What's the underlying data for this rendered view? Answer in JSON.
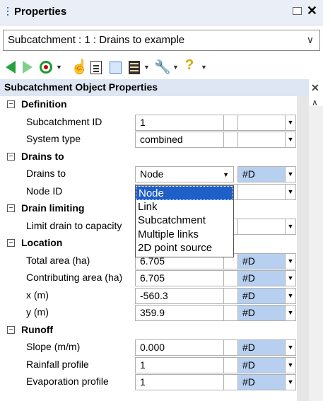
{
  "window": {
    "title": "Properties"
  },
  "object_selector": {
    "value": "Subcatchment : 1 : Drains to example"
  },
  "toolbar": {
    "icons": [
      "back-arrow-icon",
      "forward-arrow-icon",
      "target-icon",
      "hand-pointer-icon",
      "document-icon",
      "selection-icon",
      "list-icon",
      "wrench-icon",
      "help-icon"
    ]
  },
  "panel": {
    "header": "Subcatchment Object Properties"
  },
  "categories": {
    "definition": "Definition",
    "drains_to": "Drains to",
    "drain_limiting": "Drain limiting",
    "location": "Location",
    "runoff": "Runoff"
  },
  "props": {
    "subcatchment_id": {
      "label": "Subcatchment ID",
      "value": "1"
    },
    "system_type": {
      "label": "System type",
      "value": "combined"
    },
    "drains_to": {
      "label": "Drains to",
      "value": "Node",
      "unit": "#D"
    },
    "node_id": {
      "label": "Node ID",
      "value": ""
    },
    "limit_drain": {
      "label": "Limit drain to capacity",
      "value": ""
    },
    "total_area": {
      "label": "Total area (ha)",
      "value": "6.705",
      "unit": "#D"
    },
    "contributing_area": {
      "label": "Contributing area (ha)",
      "value": "6.705",
      "unit": "#D"
    },
    "x": {
      "label": "x (m)",
      "value": "-560.3",
      "unit": "#D"
    },
    "y": {
      "label": "y (m)",
      "value": "359.9",
      "unit": "#D"
    },
    "slope": {
      "label": "Slope (m/m)",
      "value": "0.000",
      "unit": "#D"
    },
    "rainfall_profile": {
      "label": "Rainfall profile",
      "value": "1",
      "unit": "#D"
    },
    "evaporation_profile": {
      "label": "Evaporation profile",
      "value": "1",
      "unit": "#D"
    }
  },
  "dropdown": {
    "options": [
      "Node",
      "Link",
      "Subcatchment",
      "Multiple links",
      "2D point source"
    ],
    "selected": "Node"
  },
  "colors": {
    "selection": "#1e5fc8",
    "unit_cell": "#b7d0ef",
    "toolbar_green": "#25a33a"
  }
}
